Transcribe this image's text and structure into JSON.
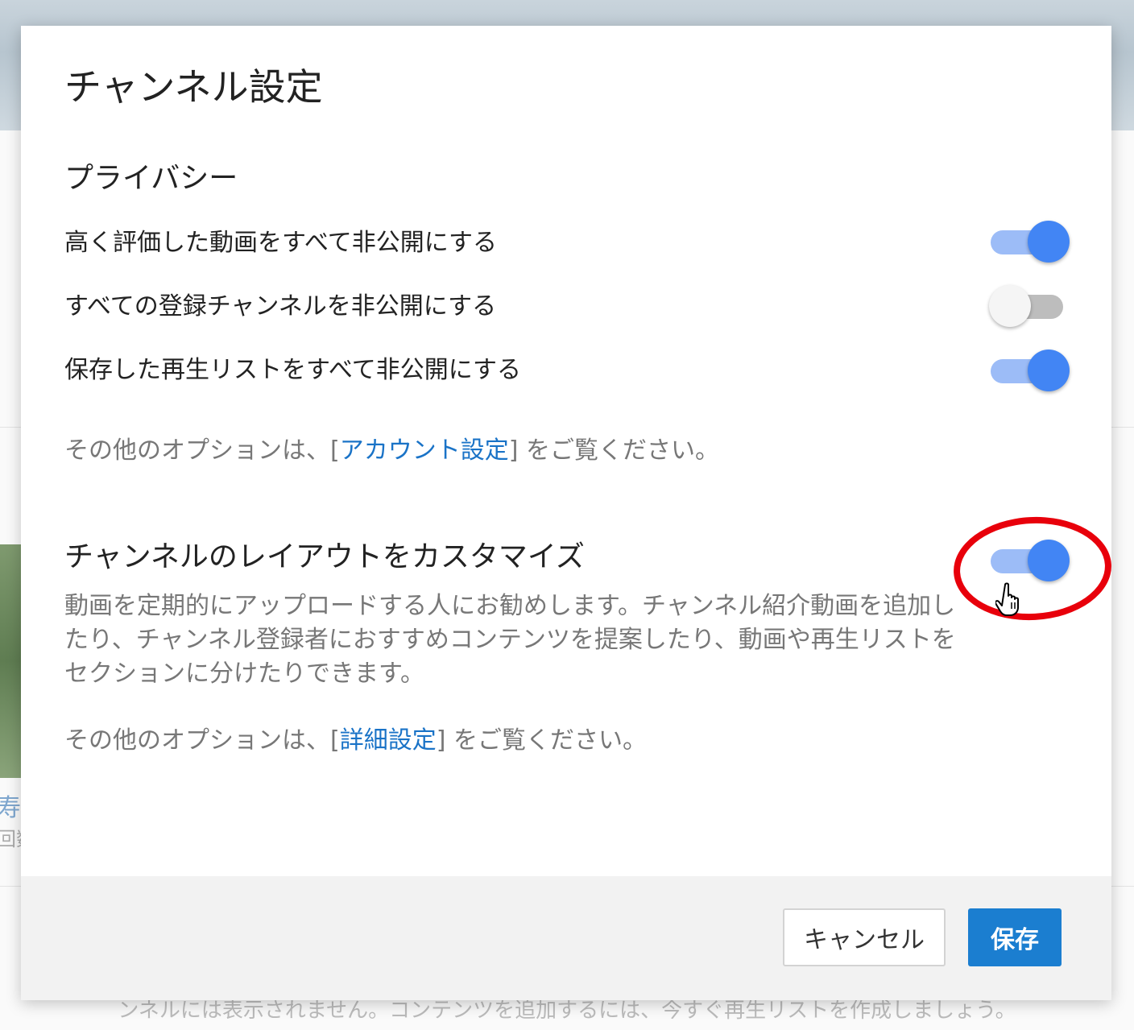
{
  "background": {
    "title_fragment": "寿",
    "subtitle_fragment": "回数",
    "bottom_text": "ンネルには表示されません。コンテンツを追加するには、今すぐ再生リストを作成しましょう。"
  },
  "dialog": {
    "title": "チャンネル設定",
    "privacy": {
      "heading": "プライバシー",
      "items": [
        {
          "label": "高く評価した動画をすべて非公開にする",
          "on": true
        },
        {
          "label": "すべての登録チャンネルを非公開にする",
          "on": false
        },
        {
          "label": "保存した再生リストをすべて非公開にする",
          "on": true
        }
      ],
      "note_prefix": "その他のオプションは、[",
      "note_link": "アカウント設定",
      "note_suffix": "] をご覧ください。"
    },
    "layout": {
      "heading": "チャンネルのレイアウトをカスタマイズ",
      "on": true,
      "description": "動画を定期的にアップロードする人にお勧めします。チャンネル紹介動画を追加したり、チャンネル登録者におすすめコンテンツを提案したり、動画や再生リストをセクションに分けたりできます。",
      "note_prefix": "その他のオプションは、[",
      "note_link": "詳細設定",
      "note_suffix": "] をご覧ください。"
    },
    "footer": {
      "cancel_label": "キャンセル",
      "save_label": "保存"
    }
  },
  "colors": {
    "accent": "#4285f4",
    "link": "#1a73c7",
    "save_button": "#1b7ed0",
    "highlight": "#e8000b"
  }
}
